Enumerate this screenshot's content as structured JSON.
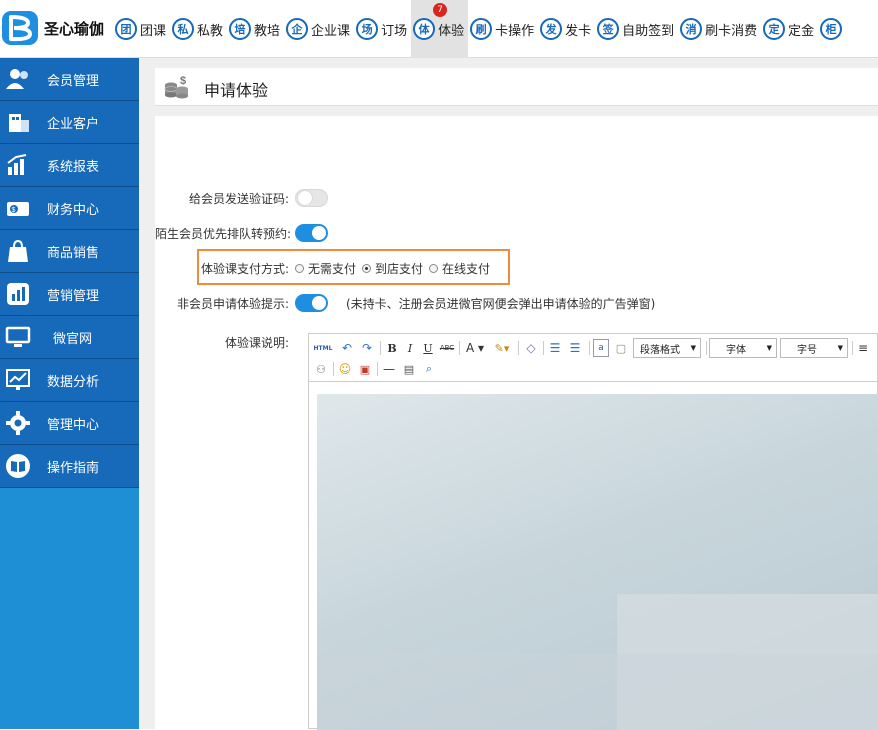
{
  "app": {
    "name": "圣心瑜伽"
  },
  "nav": [
    {
      "glyph": "团",
      "label": "团课"
    },
    {
      "glyph": "私",
      "label": "私教"
    },
    {
      "glyph": "培",
      "label": "教培"
    },
    {
      "glyph": "企",
      "label": "企业课"
    },
    {
      "glyph": "场",
      "label": "订场"
    },
    {
      "glyph": "体",
      "label": "体验",
      "badge": "7",
      "active": true
    },
    {
      "glyph": "刷",
      "label": "卡操作"
    },
    {
      "glyph": "发",
      "label": "发卡"
    },
    {
      "glyph": "签",
      "label": "自助签到"
    },
    {
      "glyph": "消",
      "label": "刷卡消费"
    },
    {
      "glyph": "定",
      "label": "定金"
    },
    {
      "glyph": "柜",
      "label": ""
    }
  ],
  "sidebar": [
    {
      "icon": "members-icon",
      "label": "会员管理"
    },
    {
      "icon": "enterprise-icon",
      "label": "企业客户"
    },
    {
      "icon": "report-icon",
      "label": "系统报表"
    },
    {
      "icon": "finance-icon",
      "label": "财务中心"
    },
    {
      "icon": "shopping-bag-icon",
      "label": "商品销售"
    },
    {
      "icon": "marketing-icon",
      "label": "营销管理"
    },
    {
      "icon": "monitor-icon",
      "label": "微官网"
    },
    {
      "icon": "analytics-icon",
      "label": "数据分析"
    },
    {
      "icon": "gear-icon",
      "label": "管理中心"
    },
    {
      "icon": "book-icon",
      "label": "操作指南"
    }
  ],
  "page": {
    "title": "申请体验"
  },
  "form": {
    "send_code_label": "给会员发送验证码:",
    "send_code_on": false,
    "queue_label": "陌生会员优先排队转预约:",
    "queue_on": true,
    "payment_label": "体验课支付方式:",
    "payment_options": [
      "无需支付",
      "到店支付",
      "在线支付"
    ],
    "payment_selected": "到店支付",
    "nonmember_label": "非会员申请体验提示:",
    "nonmember_on": true,
    "nonmember_hint": "(未持卡、注册会员进微官网便会弹出申请体验的广告弹窗)",
    "desc_label": "体验课说明:"
  },
  "editor": {
    "toolbar": {
      "html": "HTML",
      "paragraph": "段落格式",
      "font": "字体",
      "size": "字号"
    }
  }
}
